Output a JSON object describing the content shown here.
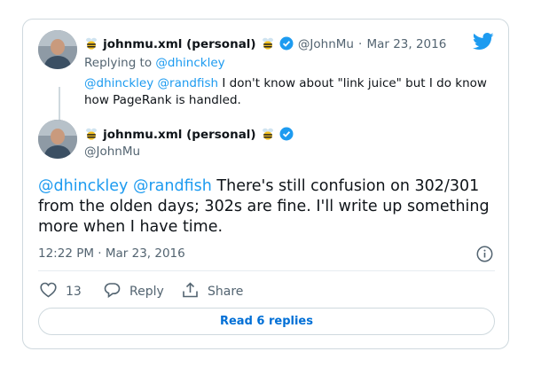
{
  "parent_tweet": {
    "display_name": "johnmu.xml (personal)",
    "handle": "@JohnMu",
    "separator": "·",
    "date": "Mar 23, 2016",
    "replying_prefix": "Replying to",
    "replying_to": "@dhinckley",
    "mentions": [
      "@dhinckley",
      "@randfish"
    ],
    "text_line1": "I don't know about \"link juice\" but I do know",
    "text_line2": "how PageRank is handled."
  },
  "main_tweet": {
    "display_name": "johnmu.xml (personal)",
    "handle": "@JohnMu",
    "mentions": [
      "@dhinckley",
      "@randfish"
    ],
    "text_line1": "There's still confusion on 302/301",
    "text_line2": "from the olden days; 302s are fine. I'll write up something",
    "text_line3": "more when I have time.",
    "timestamp": "12:22 PM · Mar 23, 2016",
    "like_count": "13",
    "reply_label": "Reply",
    "share_label": "Share",
    "read_replies_label": "Read 6 replies"
  },
  "colors": {
    "accent": "#1d9bf0",
    "text": "#0f1419",
    "muted": "#536471",
    "border": "#cfd9de"
  },
  "icons": [
    "twitter-bird-icon",
    "bee-emoji-icon",
    "verified-badge-icon",
    "info-icon",
    "heart-icon",
    "reply-bubble-icon",
    "share-icon"
  ]
}
